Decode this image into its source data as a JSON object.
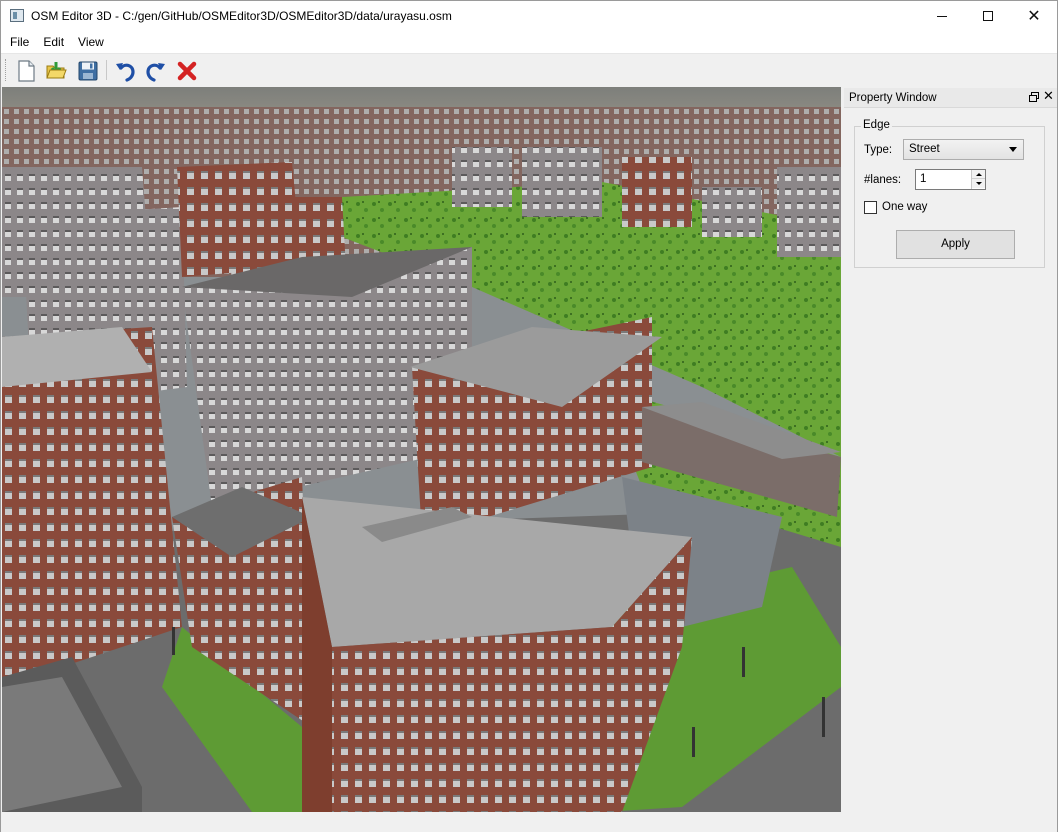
{
  "window": {
    "title": "OSM Editor 3D - C:/gen/GitHub/OSMEditor3D/OSMEditor3D/data/urayasu.osm",
    "minimize_glyph": "—",
    "maximize_glyph": "□",
    "close_glyph": "✕"
  },
  "menu": {
    "items": [
      {
        "label": "File"
      },
      {
        "label": "Edit"
      },
      {
        "label": "View"
      }
    ]
  },
  "toolbar": {
    "buttons": [
      {
        "name": "new-file-icon"
      },
      {
        "name": "open-file-icon"
      },
      {
        "name": "save-icon"
      },
      {
        "name": "undo-icon"
      },
      {
        "name": "redo-icon"
      },
      {
        "name": "delete-icon"
      }
    ]
  },
  "viewport": {
    "description_icon": "3d-city-view",
    "colors": {
      "grass": "#6aa637",
      "sky": "#8c8d86",
      "road": "#6c6c6c",
      "brick": "#8a4a3b"
    }
  },
  "property_window": {
    "title": "Property Window",
    "float_glyph": "❐",
    "close_glyph": "✕",
    "group_label": "Edge",
    "type_label": "Type:",
    "type_value": "Street",
    "lanes_label": "#lanes:",
    "lanes_value": "1",
    "one_way_label": "One way",
    "one_way_checked": false,
    "apply_label": "Apply"
  }
}
